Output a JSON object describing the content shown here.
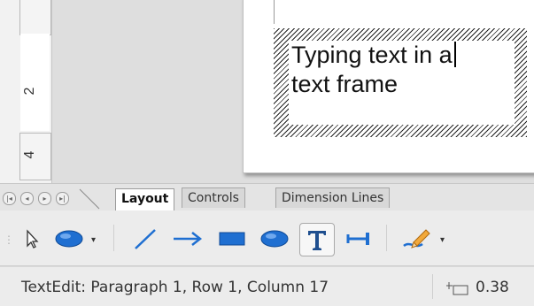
{
  "canvas": {
    "ruler_numbers": [
      "2",
      "4"
    ],
    "text_frame": {
      "line1": "Typing text in a",
      "line2": "text frame"
    }
  },
  "tabs": {
    "items": [
      "Layout",
      "Controls",
      "Dimension Lines"
    ],
    "active": "Layout"
  },
  "toolbar": {
    "tools": [
      "select-arrow-icon",
      "ellipse-icon",
      "line-icon",
      "arrow-line-icon",
      "rectangle-icon",
      "ellipse-filled-icon",
      "text-icon",
      "connector-icon",
      "curve-pencil-icon"
    ],
    "accent": "#1f6fd1"
  },
  "status": {
    "text": "TextEdit: Paragraph 1, Row 1, Column 17",
    "position_value": "0.38"
  }
}
